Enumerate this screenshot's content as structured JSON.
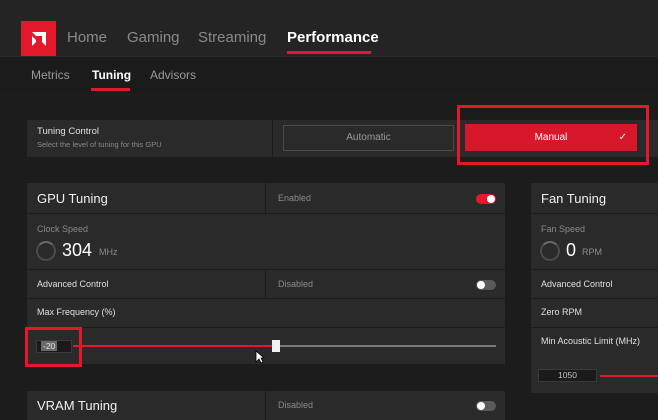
{
  "nav": {
    "tabs": [
      {
        "label": "Home"
      },
      {
        "label": "Gaming"
      },
      {
        "label": "Streaming"
      },
      {
        "label": "Performance"
      }
    ],
    "subtabs": [
      {
        "label": "Metrics"
      },
      {
        "label": "Tuning"
      },
      {
        "label": "Advisors"
      }
    ]
  },
  "tuning_control": {
    "title": "Tuning Control",
    "subtitle": "Select the level of tuning for this GPU",
    "automatic_label": "Automatic",
    "manual_label": "Manual",
    "manual_check": "✓"
  },
  "gpu_tuning": {
    "title": "GPU Tuning",
    "status": "Enabled",
    "clock_speed_label": "Clock Speed",
    "clock_speed_value": "304",
    "clock_speed_unit": "MHz",
    "advanced_control_label": "Advanced Control",
    "advanced_control_status": "Disabled",
    "max_freq_label": "Max Frequency (%)",
    "max_freq_value": "-20",
    "max_freq_fraction": 0.48
  },
  "fan_tuning": {
    "title": "Fan Tuning",
    "fan_speed_label": "Fan Speed",
    "fan_speed_value": "0",
    "fan_speed_unit": "RPM",
    "advanced_control_label": "Advanced Control",
    "zero_rpm_label": "Zero RPM",
    "min_acoustic_label": "Min Acoustic Limit (MHz)",
    "min_acoustic_value": "1050"
  },
  "vram_tuning": {
    "title": "VRAM Tuning",
    "status": "Disabled"
  },
  "colors": {
    "accent": "#e3192b",
    "background": "#1c1c1c",
    "panel": "#2a2a2a"
  },
  "icons": {
    "logo": "amd-logo-icon",
    "check": "check-icon",
    "cursor": "mouse-cursor-icon"
  }
}
